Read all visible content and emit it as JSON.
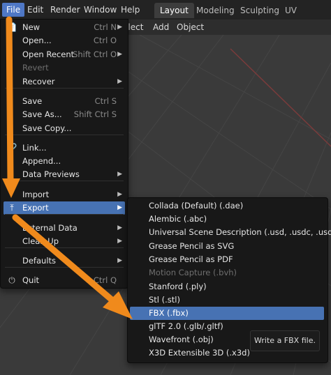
{
  "top_menu": [
    "File",
    "Edit",
    "Render",
    "Window",
    "Help"
  ],
  "workspaces": [
    "Layout",
    "Modeling",
    "Sculpting",
    "UV Editing"
  ],
  "header2": [
    "elect",
    "Add",
    "Object"
  ],
  "file_menu": [
    {
      "icon": "📄",
      "label": "New",
      "shortcut": "Ctrl N",
      "arrow": "▶"
    },
    {
      "icon": "",
      "label": "Open...",
      "shortcut": "Ctrl O",
      "arrow": ""
    },
    {
      "icon": "",
      "label": "Open Recent",
      "shortcut": "Shift Ctrl O",
      "arrow": "▶"
    },
    {
      "icon": "",
      "label": "Revert",
      "shortcut": "",
      "arrow": ""
    },
    {
      "icon": "",
      "label": "Recover",
      "shortcut": "",
      "arrow": "▶"
    },
    {
      "icon": "",
      "label": "Save",
      "shortcut": "Ctrl S",
      "arrow": ""
    },
    {
      "icon": "",
      "label": "Save As...",
      "shortcut": "Shift Ctrl S",
      "arrow": ""
    },
    {
      "icon": "",
      "label": "Save Copy...",
      "shortcut": "",
      "arrow": ""
    },
    {
      "icon": "🔗",
      "label": "Link...",
      "shortcut": "",
      "arrow": ""
    },
    {
      "icon": "",
      "label": "Append...",
      "shortcut": "",
      "arrow": ""
    },
    {
      "icon": "",
      "label": "Data Previews",
      "shortcut": "",
      "arrow": "▶"
    },
    {
      "icon": "",
      "label": "Import",
      "shortcut": "",
      "arrow": "▶"
    },
    {
      "icon": "⤒",
      "label": "Export",
      "shortcut": "",
      "arrow": "▶"
    },
    {
      "icon": "",
      "label": "External Data",
      "shortcut": "",
      "arrow": "▶"
    },
    {
      "icon": "",
      "label": "Clean Up",
      "shortcut": "",
      "arrow": "▶"
    },
    {
      "icon": "",
      "label": "Defaults",
      "shortcut": "",
      "arrow": "▶"
    },
    {
      "icon": "⏻",
      "label": "Quit",
      "shortcut": "Ctrl Q",
      "arrow": ""
    }
  ],
  "export_menu": [
    "Collada (Default) (.dae)",
    "Alembic (.abc)",
    "Universal Scene Description (.usd, .usdc, .usda)",
    "Grease Pencil as SVG",
    "Grease Pencil as PDF",
    "Motion Capture (.bvh)",
    "Stanford (.ply)",
    "Stl (.stl)",
    "FBX (.fbx)",
    "glTF 2.0 (.glb/.gltf)",
    "Wavefront (.obj)",
    "X3D Extensible 3D (.x3d)"
  ],
  "tooltip": "Write a FBX file.",
  "colors": {
    "accent": "#4772b3",
    "annotation": "#f08a1c",
    "menu_bg": "#181818"
  }
}
